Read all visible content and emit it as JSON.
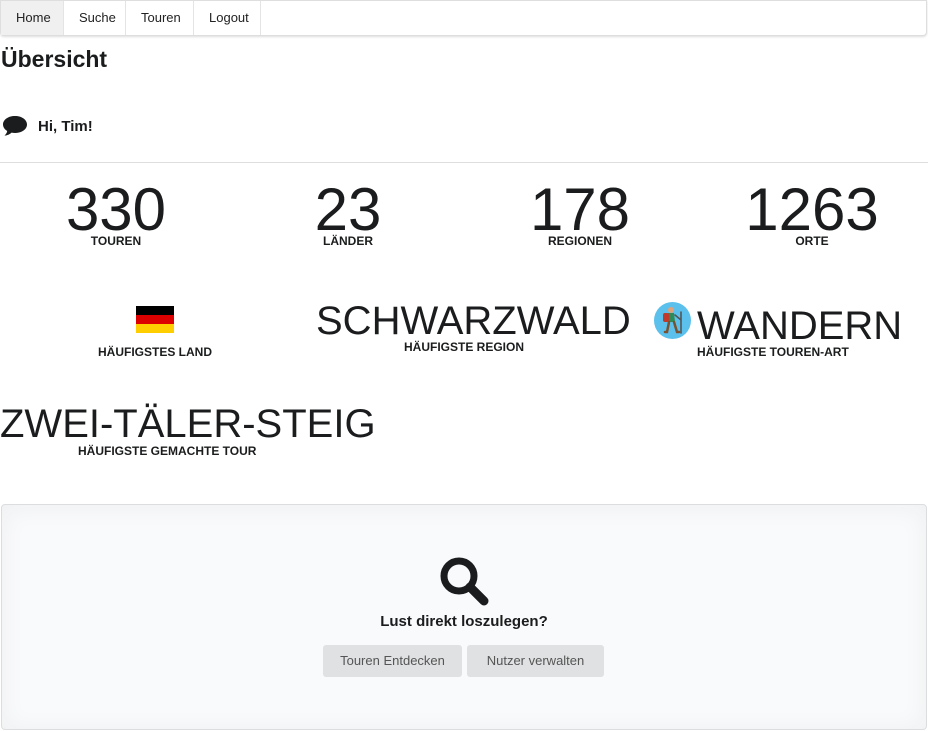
{
  "nav": {
    "items": [
      {
        "label": "Home",
        "active": true
      },
      {
        "label": "Suche"
      },
      {
        "label": "Touren"
      },
      {
        "label": "Logout"
      }
    ]
  },
  "page": {
    "title": "Übersicht"
  },
  "greeting": {
    "text": "Hi, Tim!",
    "icon": "comment-icon"
  },
  "stats": [
    {
      "value": "330",
      "label": "Touren"
    },
    {
      "value": "23",
      "label": "Länder"
    },
    {
      "value": "178",
      "label": "Regionen"
    },
    {
      "value": "1263",
      "label": "Orte"
    }
  ],
  "highlights": {
    "country": {
      "label": "Häufigstes Land",
      "flag": "germany-flag",
      "colors": [
        "#000000",
        "#dd0000",
        "#ffce00"
      ]
    },
    "region": {
      "value": "SCHWARZWALD",
      "label": "Häufigste Region"
    },
    "tour_type": {
      "value": "WANDERN",
      "label": "Häufigste Touren-Art",
      "icon": "hiker-icon"
    },
    "tour": {
      "value": "ZWEI-TÄLER-STEIG",
      "label": "Häufigste gemachte Tour"
    }
  },
  "cta": {
    "icon": "search-icon",
    "text": "Lust direkt loszulegen?",
    "buttons": [
      "Touren Entdecken",
      "Nutzer verwalten"
    ]
  },
  "colors": {
    "button_bg": "#e0e1e2",
    "segment_bg": "#f9fafb",
    "hike_icon_bg": "#5bc0eb"
  }
}
